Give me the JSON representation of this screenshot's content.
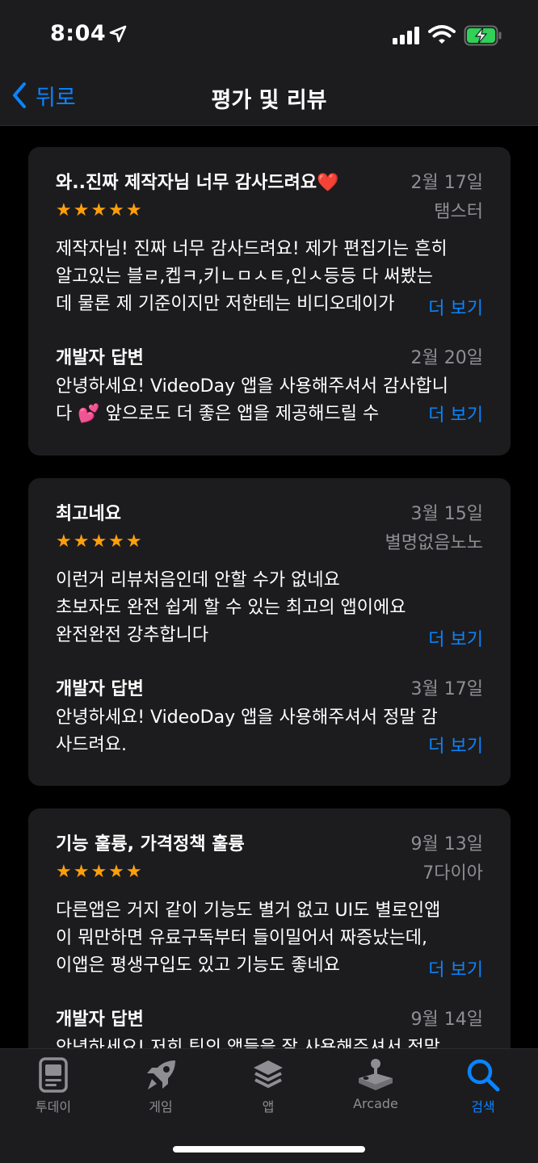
{
  "status_bar": {
    "time": "8:04"
  },
  "nav": {
    "back_label": "뒤로",
    "title": "평가 및 리뷰"
  },
  "colors": {
    "accent": "#0a84ff",
    "star": "#ff9f0a",
    "card_bg": "#1c1c1e",
    "secondary_text": "#8e8e93"
  },
  "reviews": [
    {
      "title": "와..진짜 제작자님 너무 감사드려요❤️",
      "date": "2월 17일",
      "author": "탬스터",
      "rating": 5,
      "stars": "★★★★★",
      "body": [
        "제작자님! 진짜 너무 감사드려요! 제가 편집기는 흔히",
        "알고있는 블ㄹ,켑ㅋ,키ㄴㅁㅅㅌ,인ㅅ등등 다 써봤는",
        "데 물론 제 기준이지만 저한테는 비디오데이가"
      ],
      "more_label": "더 보기",
      "dev_label": "개발자 답변",
      "dev_date": "2월 20일",
      "dev_body": [
        "안녕하세요! VideoDay 앱을 사용해주셔서 감사합니",
        "다 💕 앞으로도 더 좋은 앱을 제공해드릴 수"
      ],
      "dev_more_label": "더 보기"
    },
    {
      "title": "최고네요",
      "date": "3월 15일",
      "author": "별명없음노노",
      "rating": 5,
      "stars": "★★★★★",
      "body": [
        "이런거 리뷰처음인데 안할 수가 없네요",
        "초보자도 완전 쉽게 할 수 있는 최고의 앱이에요",
        "완전완전 강추합니다"
      ],
      "more_label": "더 보기",
      "dev_label": "개발자 답변",
      "dev_date": "3월 17일",
      "dev_body": [
        "안녕하세요! VideoDay 앱을 사용해주셔서 정말 감",
        "사드려요."
      ],
      "dev_more_label": "더 보기"
    },
    {
      "title": "기능 훌륭, 가격정책 훌륭",
      "date": "9월 13일",
      "author": "7다이아",
      "rating": 5,
      "stars": "★★★★★",
      "body": [
        "다른앱은 거지 같이 기능도 별거 없고 UI도 별로인앱",
        "이 뭐만하면 유료구독부터 들이밀어서 짜증났는데,",
        "이앱은 평생구입도 있고 기능도 좋네요"
      ],
      "more_label": "더 보기",
      "dev_label": "개발자 답변",
      "dev_date": "9월 14일",
      "dev_body": [
        "안녕하세요! 저희 팀의 앱들을 잘 사용해주셔서 정말"
      ],
      "dev_more_label": ""
    }
  ],
  "tabs": [
    {
      "label": "투데이",
      "icon": "today-icon",
      "active": false
    },
    {
      "label": "게임",
      "icon": "rocket-icon",
      "active": false
    },
    {
      "label": "앱",
      "icon": "layers-icon",
      "active": false
    },
    {
      "label": "Arcade",
      "icon": "joystick-icon",
      "active": false
    },
    {
      "label": "검색",
      "icon": "search-icon",
      "active": true
    }
  ]
}
